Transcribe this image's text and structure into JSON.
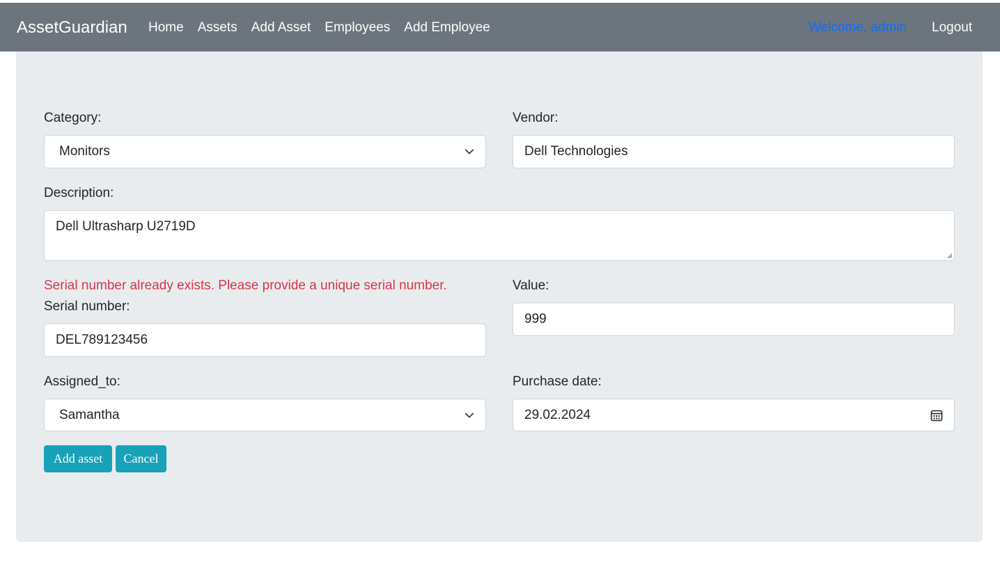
{
  "navbar": {
    "brand": "AssetGuardian",
    "links": [
      "Home",
      "Assets",
      "Add Asset",
      "Employees",
      "Add Employee"
    ],
    "welcome": "Welcome, admin",
    "logout": "Logout"
  },
  "form": {
    "category": {
      "label": "Category:",
      "value": "Monitors"
    },
    "vendor": {
      "label": "Vendor:",
      "value": "Dell Technologies"
    },
    "description": {
      "label": "Description:",
      "value": "Dell Ultrasharp U2719D"
    },
    "serial_error": "Serial number already exists. Please provide a unique serial number.",
    "serial": {
      "label": "Serial number:",
      "value": "DEL789123456"
    },
    "value": {
      "label": "Value:",
      "value": "999"
    },
    "assigned_to": {
      "label": "Assigned_to:",
      "value": "Samantha"
    },
    "purchase_date": {
      "label": "Purchase date:",
      "value": "29.02.2024"
    },
    "buttons": {
      "add": "Add asset",
      "cancel": "Cancel"
    }
  },
  "icons": {
    "dropdown": "chevron-down-icon",
    "date": "calendar-icon",
    "resize": "resize-grip-icon"
  },
  "colors": {
    "navbar_bg": "#6c757d",
    "card_bg": "#e9ecef",
    "error": "#dc3545",
    "welcome_link": "#0d6efd",
    "button": "#17a2b8"
  }
}
